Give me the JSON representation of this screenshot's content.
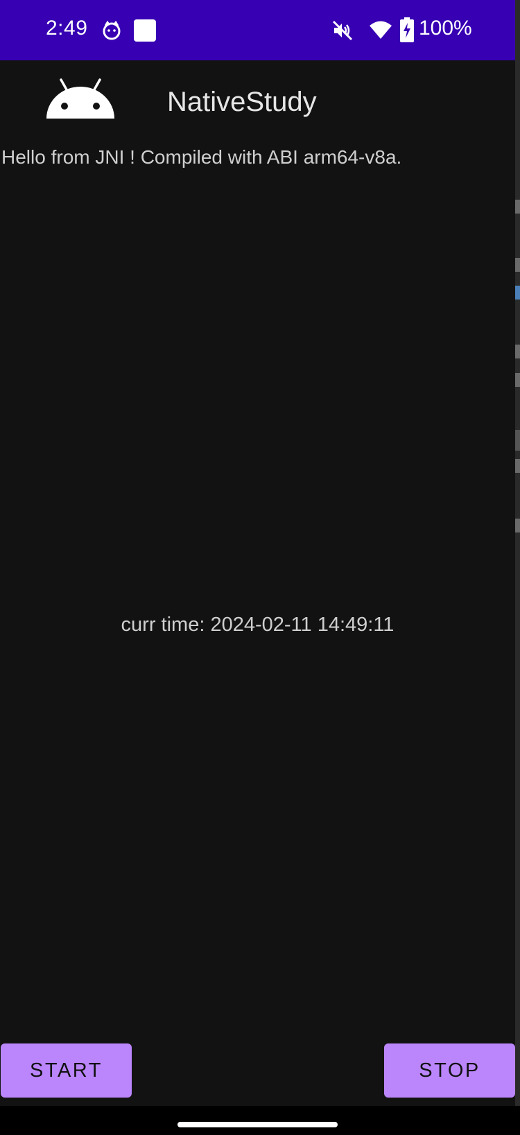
{
  "status_bar": {
    "time": "2:49",
    "battery_percent": "100%",
    "icons": [
      "cat-notification-icon",
      "square-notification-icon",
      "mute-icon",
      "wifi-icon",
      "battery-charging-icon"
    ],
    "background_color": "#3700B3"
  },
  "toolbar": {
    "logo_icon": "android-robot-icon",
    "title": "NativeStudy"
  },
  "main": {
    "hello_text": "Hello from JNI !  Compiled with ABI arm64-v8a.",
    "curr_time_text": "curr time: 2024-02-11 14:49:11"
  },
  "buttons": {
    "start_label": "START",
    "stop_label": "STOP",
    "accent_color": "#BB86FC"
  },
  "navigation": {
    "gesture_bar": "gesture-handle"
  }
}
